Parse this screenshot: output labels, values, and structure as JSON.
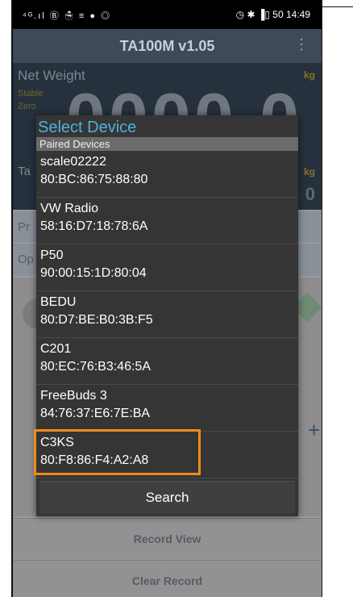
{
  "status_bar": {
    "left_icons": "⁴ᴳ.ıl Ⓑ ☃ ≡ ● ◎",
    "right_text": "◷ ✱ ▐▯ 50 14:49"
  },
  "app": {
    "title": "TA100M v1.05",
    "menu_icon": "⋮"
  },
  "weight": {
    "net_label": "Net Weight",
    "unit": "kg",
    "stable": "Stable",
    "zero": "Zero",
    "value": "0000.0",
    "tare_label": "Ta",
    "tare_unit": "kg",
    "tare_value": "0"
  },
  "rows": {
    "pr": "Pr",
    "op": "Op",
    "plus": "+"
  },
  "buttons": {
    "record_view": "Record View",
    "clear_record": "Clear Record"
  },
  "dialog": {
    "title": "Select Device",
    "subtitle": "Paired Devices",
    "devices": [
      {
        "name": "scale02222",
        "address": "80:BC:86:75:88:80"
      },
      {
        "name": "VW Radio",
        "address": "58:16:D7:18:78:6A"
      },
      {
        "name": "P50",
        "address": "90:00:15:1D:80:04"
      },
      {
        "name": "BEDU",
        "address": "80:D7:BE:B0:3B:F5"
      },
      {
        "name": "C201",
        "address": "80:EC:76:B3:46:5A"
      },
      {
        "name": "FreeBuds 3",
        "address": "84:76:37:E6:7E:BA"
      },
      {
        "name": "C3KS",
        "address": "80:F8:86:F4:A2:A8"
      }
    ],
    "search_label": "Search",
    "highlight_color": "#f08a1c",
    "title_color": "#4fb2dd"
  }
}
